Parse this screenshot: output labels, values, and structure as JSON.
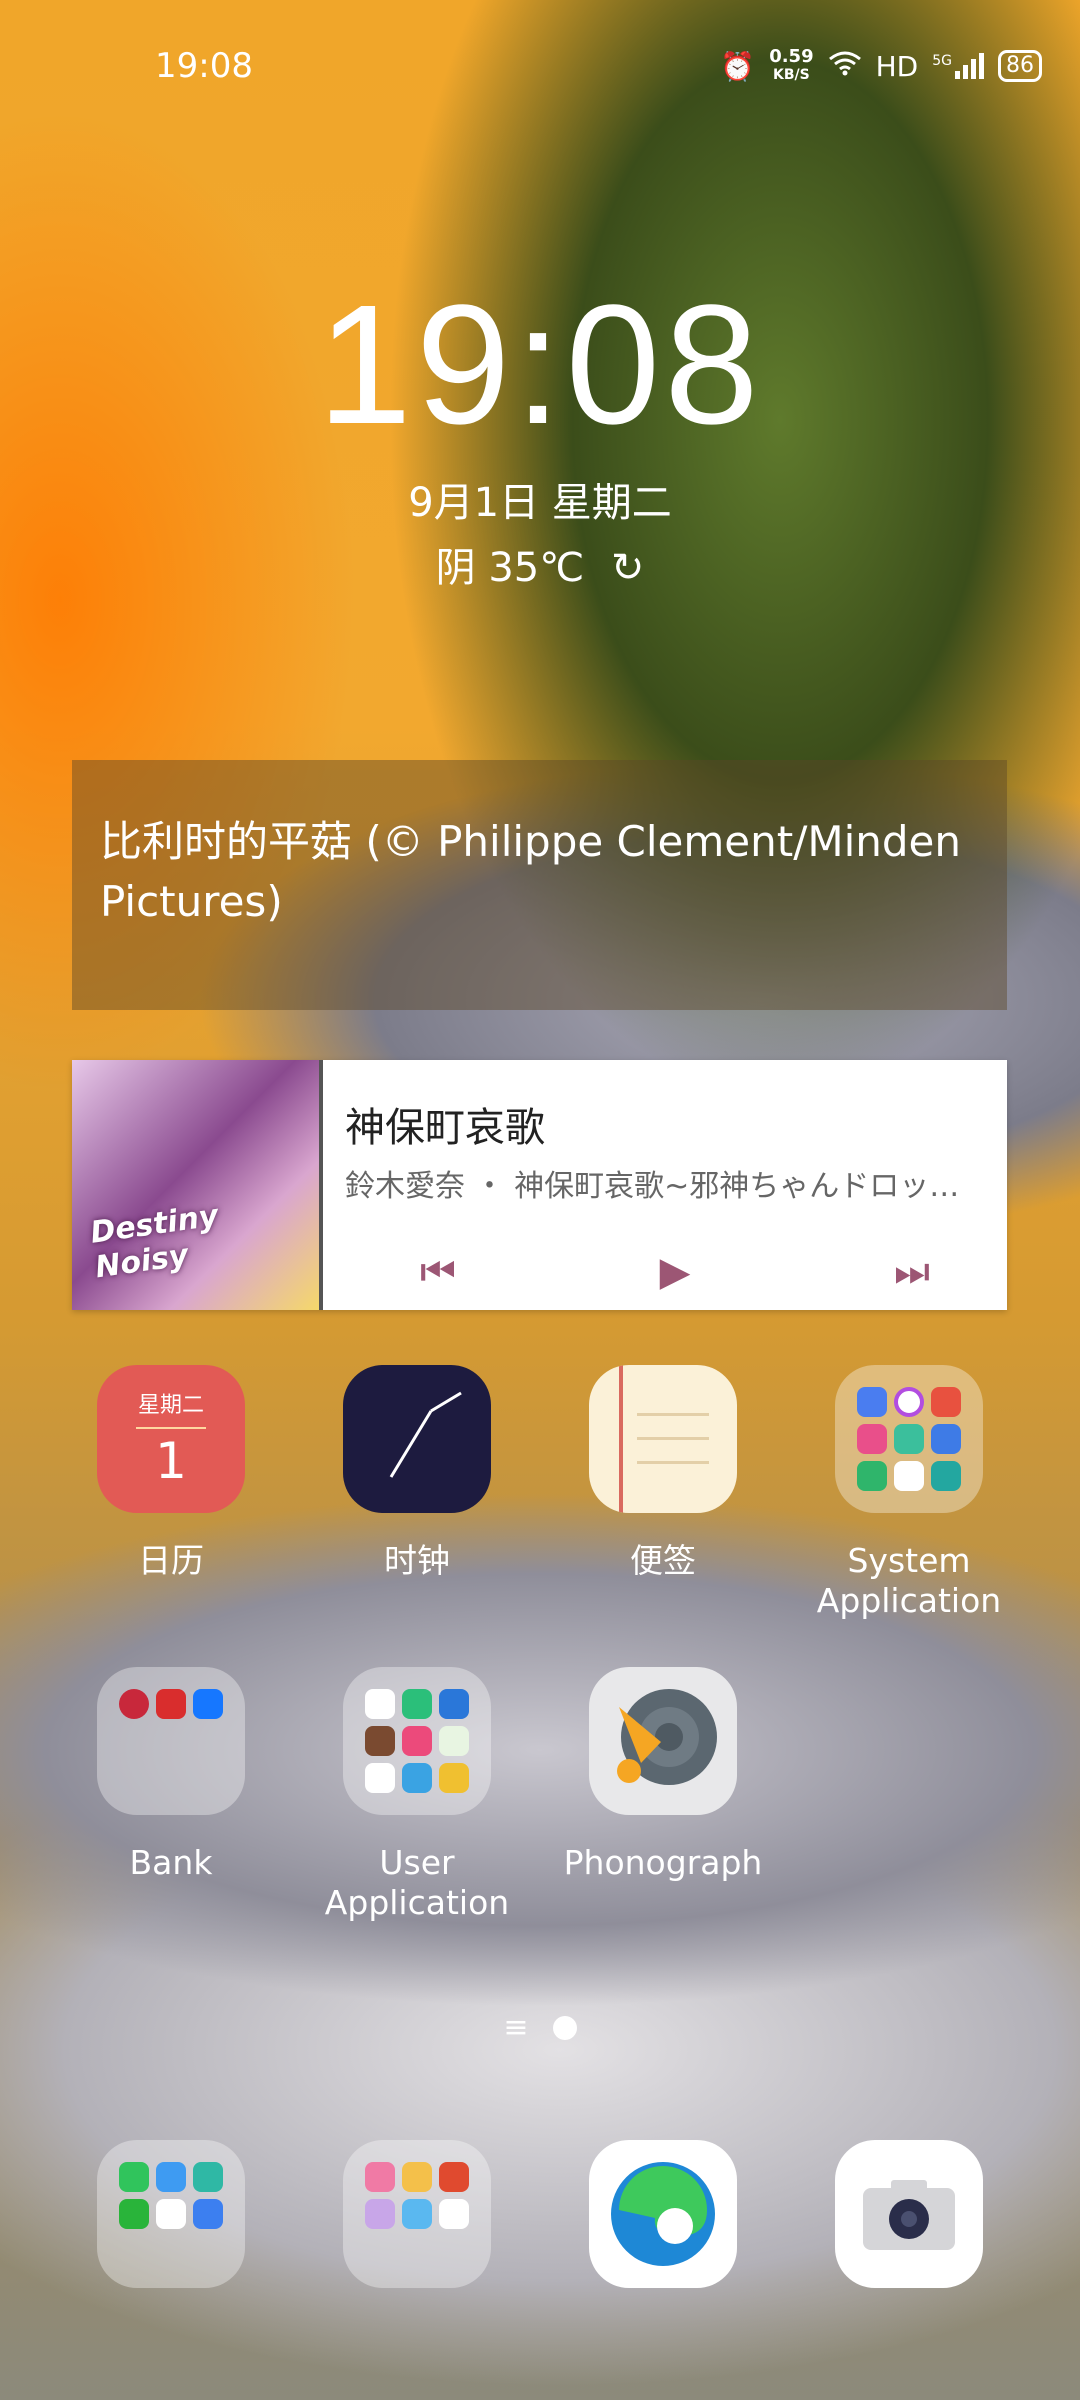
{
  "status_bar": {
    "time": "19:08",
    "net_speed_value": "0.59",
    "net_speed_unit": "KB/S",
    "hd": "HD",
    "network": "5G",
    "battery": "86"
  },
  "lockscreen": {
    "clock": "19:08",
    "date": "9月1日 星期二",
    "weather": "阴 35℃"
  },
  "wallpaper_caption": "比利时的平菇 (© Philippe Clement/Minden Pictures)",
  "music": {
    "song": "神保町哀歌",
    "artist_album": "鈴木愛奈 ・ 神保町哀歌~邪神ちゃんドロップ…",
    "album_text": "Destiny Noisy",
    "prev": "⏮",
    "play": "▶",
    "next": "⏭"
  },
  "apps_row1": [
    {
      "label": "日历",
      "icon": "calendar-icon",
      "day": "星期二",
      "date": "1"
    },
    {
      "label": "时钟",
      "icon": "clock-icon"
    },
    {
      "label": "便签",
      "icon": "notes-icon"
    },
    {
      "label": "System\nApplication",
      "icon": "folder-icon"
    }
  ],
  "apps_row2": [
    {
      "label": "Bank",
      "icon": "folder-icon"
    },
    {
      "label": "User\nApplication",
      "icon": "folder-icon"
    },
    {
      "label": "Phonograph",
      "icon": "phonograph-icon"
    }
  ],
  "page_indicator": {
    "menu": "≡"
  },
  "dock": [
    {
      "icon": "folder-icon"
    },
    {
      "icon": "folder-icon"
    },
    {
      "icon": "edge-browser-icon"
    },
    {
      "icon": "camera-icon"
    }
  ],
  "colors": {
    "calendar": "#e25a55",
    "clock_bg": "#1d1b3f",
    "notes_bg": "#fbf1d8",
    "music_accent": "#9c5674"
  }
}
